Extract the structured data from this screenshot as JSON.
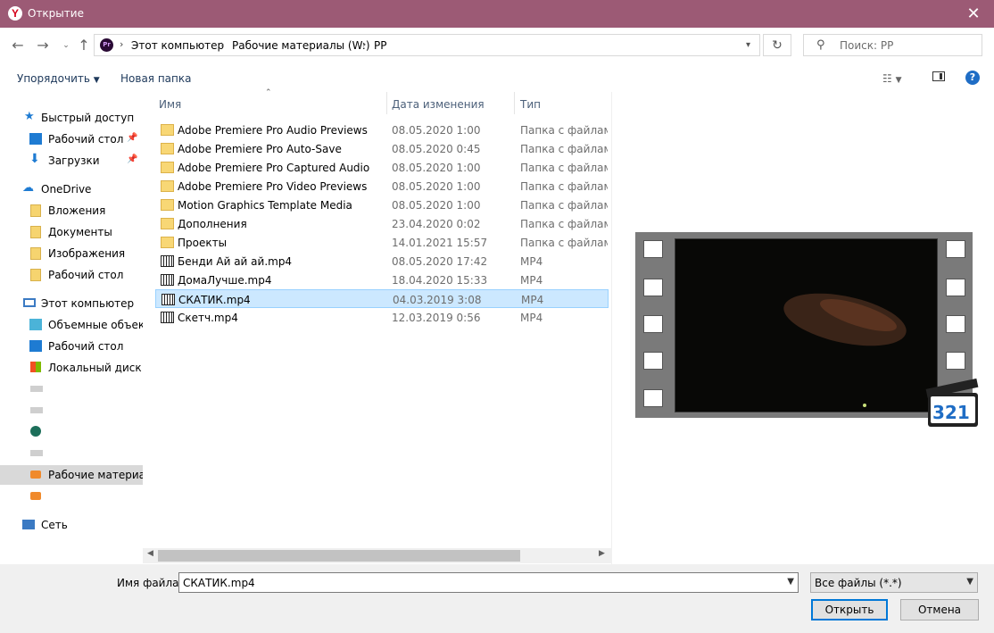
{
  "window": {
    "title": "Открытие",
    "app_icon": "yandex-icon",
    "close": "✕"
  },
  "address": {
    "segments": [
      "Этот компьютер",
      "Рабочие материалы (W:)",
      "PP"
    ],
    "search_placeholder": "Поиск: PP"
  },
  "toolbar": {
    "organize": "Упорядочить",
    "new_folder": "Новая папка"
  },
  "nav": {
    "quick_access": "Быстрый доступ",
    "quick_desktop": "Рабочий стол",
    "quick_downloads": "Загрузки",
    "onedrive": "OneDrive",
    "od_attachments": "Вложения",
    "od_documents": "Документы",
    "od_images": "Изображения",
    "od_desktop": "Рабочий стол",
    "this_pc": "Этот компьютер",
    "pc_3d": "Объемные объекты",
    "pc_desktop": "Рабочий стол",
    "pc_local": "Локальный диск (C",
    "pc_work": "Рабочие материал",
    "network": "Сеть"
  },
  "columns": {
    "name": "Имя",
    "date": "Дата изменения",
    "type": "Тип"
  },
  "files": [
    {
      "name": "Adobe Premiere Pro Audio Previews",
      "date": "08.05.2020 1:00",
      "type": "Папка с файлами",
      "kind": "folder"
    },
    {
      "name": "Adobe Premiere Pro Auto-Save",
      "date": "08.05.2020 0:45",
      "type": "Папка с файлами",
      "kind": "folder"
    },
    {
      "name": "Adobe Premiere Pro Captured Audio",
      "date": "08.05.2020 1:00",
      "type": "Папка с файлами",
      "kind": "folder"
    },
    {
      "name": "Adobe Premiere Pro Video Previews",
      "date": "08.05.2020 1:00",
      "type": "Папка с файлами",
      "kind": "folder"
    },
    {
      "name": "Motion Graphics Template Media",
      "date": "08.05.2020 1:00",
      "type": "Папка с файлами",
      "kind": "folder"
    },
    {
      "name": "Дополнения",
      "date": "23.04.2020 0:02",
      "type": "Папка с файлами",
      "kind": "folder"
    },
    {
      "name": "Проекты",
      "date": "14.01.2021 15:57",
      "type": "Папка с файлами",
      "kind": "folder"
    },
    {
      "name": "Бенди Ай ай ай.mp4",
      "date": "08.05.2020 17:42",
      "type": "MP4",
      "kind": "mp4"
    },
    {
      "name": "ДомаЛучше.mp4",
      "date": "18.04.2020 15:33",
      "type": "MP4",
      "kind": "mp4"
    },
    {
      "name": "СКАТИК.mp4",
      "date": "04.03.2019 3:08",
      "type": "MP4",
      "kind": "mp4"
    },
    {
      "name": "Скетч.mp4",
      "date": "12.03.2019 0:56",
      "type": "MP4",
      "kind": "mp4"
    }
  ],
  "filename": {
    "label": "Имя файла:",
    "value": "СКАТИК.mp4"
  },
  "filetype": {
    "value": "Все файлы (*.*)"
  },
  "buttons": {
    "open": "Открыть",
    "cancel": "Отмена"
  },
  "preview": {
    "logo_text": "321"
  }
}
